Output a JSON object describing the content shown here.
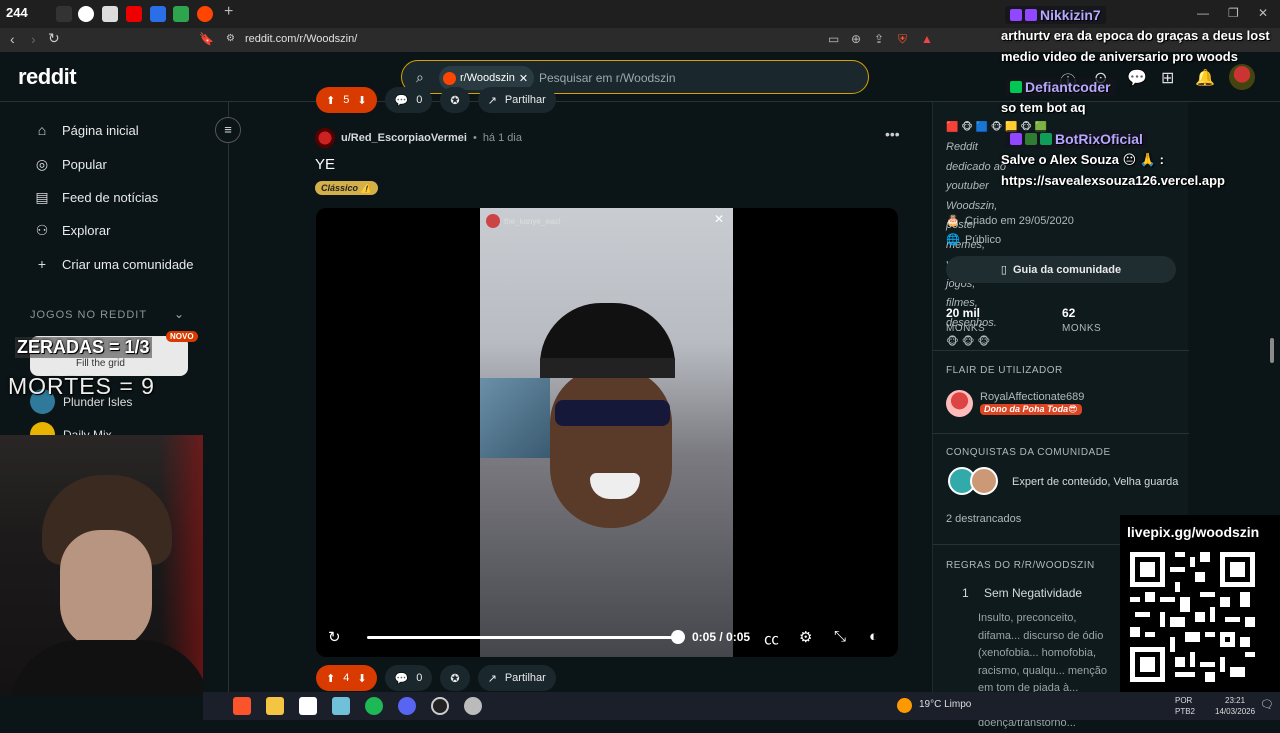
{
  "browser": {
    "tab_count": "244",
    "url": "reddit.com/r/Woodszin/"
  },
  "header": {
    "logo": "reddit",
    "search_chip": "r/Woodszin",
    "search_placeholder": "Pesquisar em r/Woodszin"
  },
  "sidebar": {
    "items": [
      {
        "label": "Página inicial",
        "icon": "home-icon"
      },
      {
        "label": "Popular",
        "icon": "popular-icon"
      },
      {
        "label": "Feed de notícias",
        "icon": "news-icon"
      },
      {
        "label": "Explorar",
        "icon": "explore-icon"
      },
      {
        "label": "Criar uma comunidade",
        "icon": "plus-icon"
      }
    ],
    "games_heading": "JOGOS NO REDDIT",
    "game_card_sub": "Fill the grid",
    "new_badge": "NOVO",
    "game_items": [
      "Plunder Isles",
      "Daily Mix"
    ]
  },
  "overlay": {
    "zeradas": "ZERADAS = 1/3",
    "mortes": "MORTES = 9"
  },
  "previous_post": {
    "votes": "5",
    "comments": "0",
    "share": "Partilhar"
  },
  "post": {
    "user": "u/Red_EscorpiaoVermei",
    "separator": "•",
    "time": "há 1 dia",
    "title": "YE",
    "flair": "Clássico ⚠️",
    "video": {
      "account": "the_kanye_east",
      "time": "0:05 / 0:05",
      "progress": 1.0
    },
    "votes": "4",
    "comments": "0",
    "share": "Partilhar"
  },
  "right": {
    "description": "Reddit dedicado ao youtuber Woodszin, poster memes, vídeos, jogos, filmes, desenhos. 🐵 🐵 🐵",
    "created": "Criado em 29/05/2020",
    "visibility": "Público",
    "guide_button": "Guia da comunidade",
    "stats": [
      {
        "value": "20 mil",
        "label": "MONKS"
      },
      {
        "value": "62",
        "label": "MONKS"
      }
    ],
    "user_flair_heading": "FLAIR DE UTILIZADOR",
    "user_flair_name": "RoyalAffectionate689",
    "user_flair_tag": "Dono da Poha Toda😎",
    "achievements_heading": "CONQUISTAS DA COMUNIDADE",
    "achievements_text": "Expert de conteúdo, Velha guarda",
    "unlocked": "2 destrancados",
    "rules_heading": "REGRAS DO R/R/WOODSZIN",
    "rule_number": "1",
    "rule_title": "Sem Negatividade",
    "rule_body": "Insulto, preconceito, difama... discurso de ódio (xenofobia... homofobia, racismo, qualqu... menção em tom de piada à... qualquer doença/transtorno..."
  },
  "chat": [
    {
      "name": "Nikkizin7",
      "message": "arthurtv era da epoca do graças a deus lost medio video de aniversario pro woods",
      "badge_color": "#9146ff",
      "name_color": "#b6a8ff"
    },
    {
      "name": "Defiantcoder",
      "message": "so tem bot aq",
      "badge_color": "#00c853",
      "name_color": "#b6a8ff"
    },
    {
      "name": "BotRixOficial",
      "message": "Salve o Alex Souza 😐 🙏 : https://savealexsouza126.vercel.app",
      "badge_color": "#2e7d32",
      "name_color": "#b6a8ff"
    }
  ],
  "livepix": "livepix.gg/woodszin",
  "taskbar": {
    "weather": "19°C  Limpo",
    "lang": "POR",
    "lang2": "PTB2",
    "clock_time": "23:21",
    "clock_date": "14/03/2026"
  },
  "colors": {
    "accent": "#d93a00",
    "search_border": "#d7a200",
    "background": "#0b1416"
  }
}
